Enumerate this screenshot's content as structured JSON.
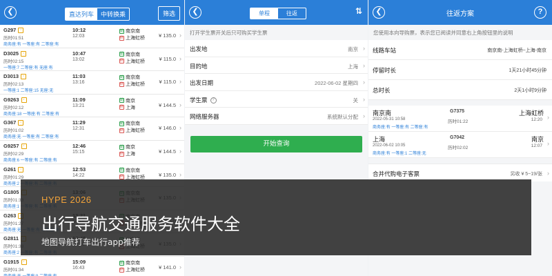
{
  "panel1": {
    "tabs": [
      "直达列车",
      "中转换乘"
    ],
    "filter": "筛选",
    "trains": [
      {
        "no": "G297",
        "dur": "历时01:51",
        "seats": "商务座:有  一等座:有  二等座:有",
        "dep": "10:12",
        "arr": "12:03",
        "from": "南京南",
        "to": "上海虹桥",
        "price": "¥ 135.0"
      },
      {
        "no": "D3025",
        "dur": "历时02:15",
        "seats": "一等座:7  二等座:有  无座:有",
        "dep": "10:47",
        "arr": "13:02",
        "from": "南京南",
        "to": "上海虹桥",
        "price": "¥ 115.0"
      },
      {
        "no": "D3013",
        "dur": "历时02:13",
        "seats": "一等座:1  二等座:15  无座:无",
        "dep": "11:03",
        "arr": "13:16",
        "from": "南京南",
        "to": "上海虹桥",
        "price": "¥ 115.0"
      },
      {
        "no": "G9263",
        "dur": "历时02:12",
        "seats": "商务座:18  一等座:有  二等座:有",
        "dep": "11:09",
        "arr": "13:21",
        "from": "南京",
        "to": "上海",
        "price": "¥ 144.5"
      },
      {
        "no": "G367",
        "dur": "历时01:02",
        "seats": "商务座:无  一等座:有  二等座:有",
        "dep": "11:29",
        "arr": "12:31",
        "from": "南京南",
        "to": "上海虹桥",
        "price": "¥ 146.0"
      },
      {
        "no": "G9257",
        "dur": "历时02:29",
        "seats": "商务座:6  一等座:有  二等座:有",
        "dep": "12:46",
        "arr": "15:15",
        "from": "南京",
        "to": "上海",
        "price": "¥ 144.5"
      },
      {
        "no": "G261",
        "dur": "历时01:29",
        "seats": "商务座:2  一等座:有  二等座:有",
        "dep": "12:53",
        "arr": "14:22",
        "from": "南京南",
        "to": "上海虹桥",
        "price": "¥ 135.0"
      },
      {
        "no": "G1805",
        "dur": "历时01:33",
        "seats": "商务座:1  一等座:有  二等座:有",
        "dep": "13:06",
        "arr": "14:39",
        "from": "南京南",
        "to": "上海虹桥",
        "price": "¥ 135.0"
      },
      {
        "no": "G263",
        "dur": "历时01:27",
        "seats": "商务座:无  一等座:有  二等座:有",
        "dep": "13:21",
        "arr": "14:48",
        "from": "南京南",
        "to": "上海虹桥",
        "price": "¥ 135.0"
      },
      {
        "no": "G2811",
        "dur": "历时01:38",
        "seats": "商务座:2  一等座:有  二等座:有",
        "dep": "13:40",
        "arr": "15:18",
        "from": "南京南",
        "to": "上海虹桥",
        "price": "¥ 135.0"
      },
      {
        "no": "G1915",
        "dur": "历时01:34",
        "seats": "商务座:无  一等座:9  二等座:有",
        "dep": "15:09",
        "arr": "16:43",
        "from": "南京南",
        "to": "上海虹桥",
        "price": "¥ 141.0"
      }
    ]
  },
  "panel2": {
    "tabs": [
      "单程",
      "往返"
    ],
    "note": "打开学生票开关后只可购买学生票",
    "rows": [
      {
        "label": "出发地",
        "value": "南京"
      },
      {
        "label": "目的地",
        "value": "上海"
      },
      {
        "label": "出发日期",
        "value": "2022-06-02 星期四"
      },
      {
        "label": "学生票",
        "value": "关"
      },
      {
        "label": "网络服务器",
        "value": "系统默认分配"
      }
    ],
    "query": "开始查询"
  },
  "panel3": {
    "title": "往返方案",
    "note": "您使用本向导购票，表示您已阅读并同意右上角按钮里的说明",
    "rows": [
      {
        "label": "线路车站",
        "value": "南京南-上海虹桥~上海-南京"
      },
      {
        "label": "停留时长",
        "value": "1天21小时45分钟"
      },
      {
        "label": "总时长",
        "value": "2天1小时9分钟"
      }
    ],
    "legs": [
      {
        "from": "南京南",
        "date": "2022-05-31 10:58",
        "seats": "商务座:有  一等座:有  二等座:有",
        "no": "G7375",
        "dur": "历时01:22",
        "to": "上海虹桥",
        "arr": "12:20"
      },
      {
        "from": "上海",
        "date": "2022-06-02 10:05",
        "seats": "商务座:有  一等座:1  二等座:无",
        "no": "G7042",
        "dur": "历时02:02",
        "to": "南京",
        "arr": "12:07"
      }
    ],
    "combine": {
      "label": "合并代购电子客票",
      "value": "另收 ¥ 5~19/张"
    }
  },
  "banner": {
    "tag": "HYPE 2026",
    "title": "出行导航交通服务软件大全",
    "subtitle": "地图导航打车出行app推荐"
  },
  "colors": {
    "brand": "#2b7fd8",
    "accent": "#2fae4f",
    "tag": "#f2a33a"
  }
}
